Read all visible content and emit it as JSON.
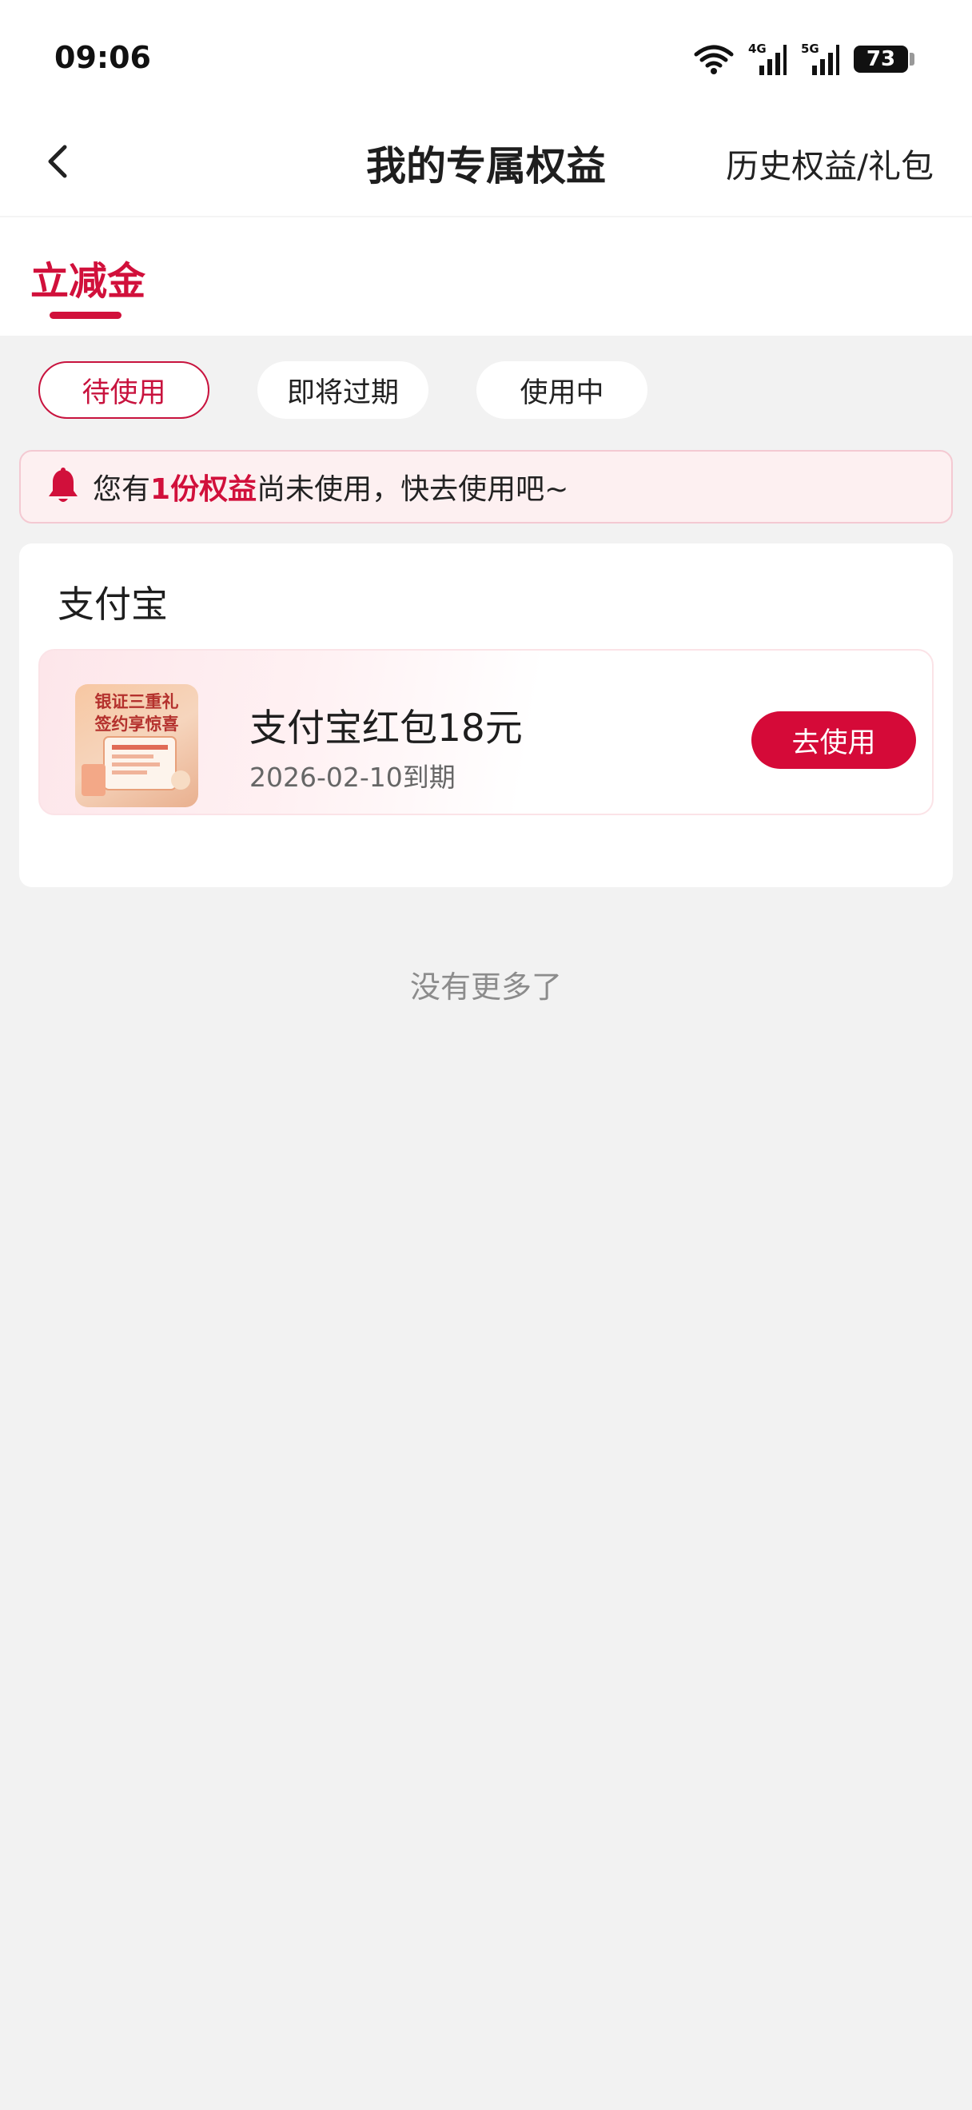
{
  "status_bar": {
    "time": "09:06",
    "battery_level": "73",
    "signal_labels": [
      "4G",
      "5G"
    ],
    "icons": [
      "wifi-icon",
      "signal-4g-icon",
      "signal-5g-icon",
      "battery-icon"
    ]
  },
  "nav": {
    "title": "我的专属权益",
    "history_link": "历史权益/礼包",
    "back_icon": "chevron-left-icon"
  },
  "category_tab": {
    "active_label": "立减金"
  },
  "filters": [
    {
      "label": "待使用",
      "active": true
    },
    {
      "label": "即将过期",
      "active": false
    },
    {
      "label": "使用中",
      "active": false
    }
  ],
  "notice": {
    "icon": "bell-icon",
    "prefix": "您有",
    "highlight": "1份权益",
    "suffix": "尚未使用，快去使用吧~"
  },
  "card": {
    "section_title": "支付宝",
    "coupon": {
      "thumb_text_line1": "银证三重礼",
      "thumb_text_line2": "签约享惊喜",
      "title": "支付宝红包18元",
      "expiry": "2026-02-10到期",
      "button_label": "去使用"
    }
  },
  "footer": {
    "no_more": "没有更多了"
  },
  "colors": {
    "accent": "#d1103b",
    "background": "#f2f2f2",
    "notice_bg": "#fdf0f1"
  }
}
